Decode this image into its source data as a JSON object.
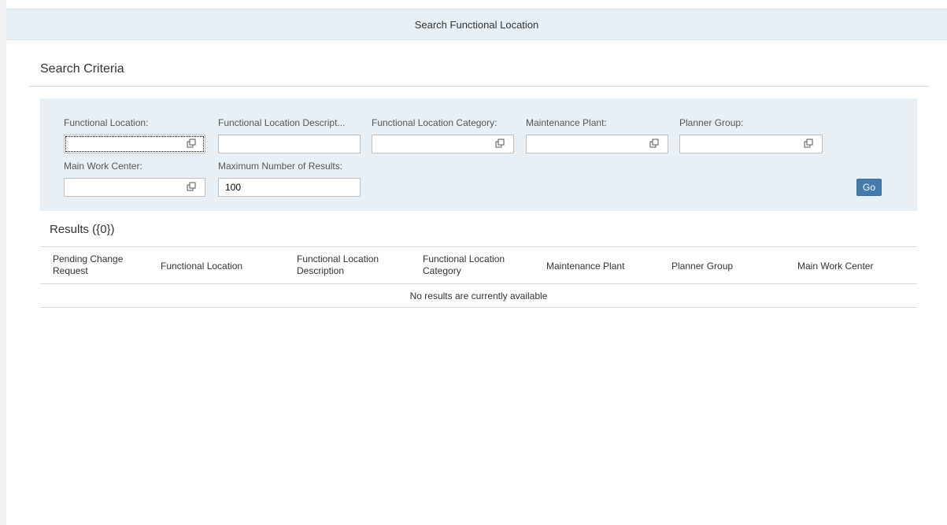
{
  "header": {
    "title": "Search Functional Location"
  },
  "criteria": {
    "title": "Search Criteria",
    "fields": [
      {
        "label": "Functional Location:",
        "value": ""
      },
      {
        "label": "Functional Location Descript...",
        "value": ""
      },
      {
        "label": "Functional Location Category:",
        "value": ""
      },
      {
        "label": "Maintenance Plant:",
        "value": ""
      },
      {
        "label": "Planner Group:",
        "value": ""
      },
      {
        "label": "Main Work Center:",
        "value": ""
      },
      {
        "label": "Maximum Number of Results:",
        "value": "100"
      }
    ],
    "go_label": "Go",
    "value_help_icon": "value-help-icon"
  },
  "results": {
    "title": "Results ({0})",
    "columns": [
      "Pending Change\nRequest",
      "Functional Location",
      "Functional Location\nDescription",
      "Functional Location\nCategory",
      "Maintenance Plant",
      "Planner Group",
      "Main Work Center"
    ],
    "empty_text": "No results are currently available"
  },
  "colors": {
    "panel_bg": "#e8f0f6",
    "button_bg": "#427cac"
  }
}
